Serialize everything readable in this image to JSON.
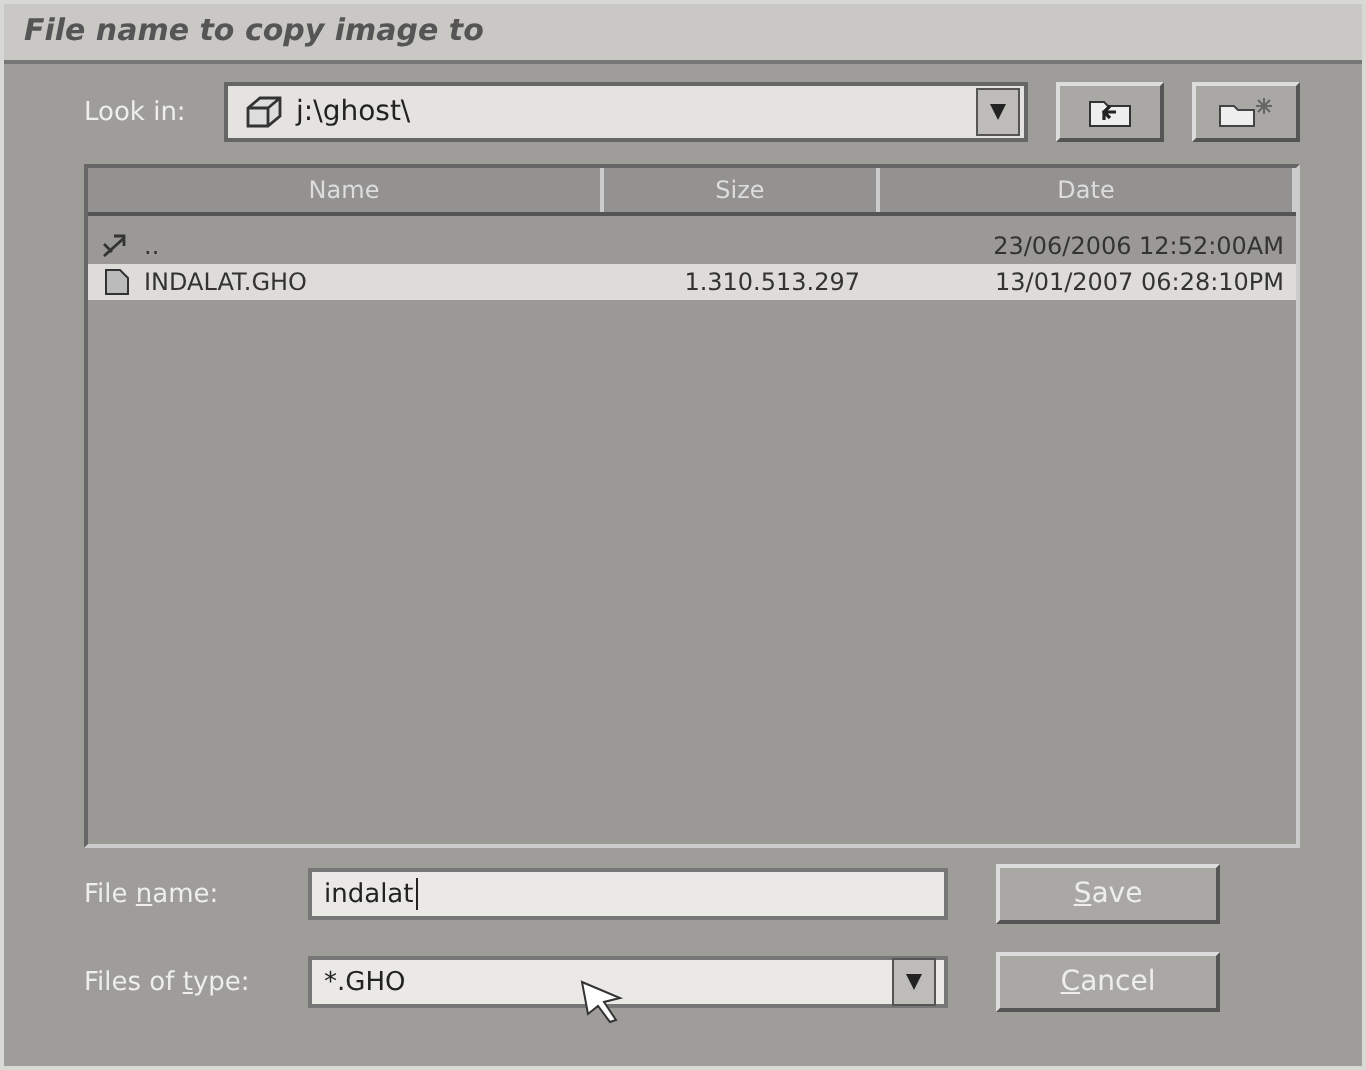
{
  "window": {
    "title": "File name to copy image to"
  },
  "look_in": {
    "label": "Look in:",
    "value": "j:\\ghost\\"
  },
  "table": {
    "columns": [
      "Name",
      "Size",
      "Date"
    ],
    "rows": [
      {
        "name": "..",
        "date": "23/06/2006 12:52:00AM",
        "kind": "parent",
        "selected": false
      },
      {
        "name": "INDALAT.GHO",
        "size": "1.310.513.297",
        "date": "13/01/2007 06:28:10PM",
        "kind": "file",
        "selected": true
      }
    ]
  },
  "file_name": {
    "label": {
      "before": "File ",
      "underlined": "n",
      "after": "ame:"
    },
    "value": "indalat"
  },
  "file_type": {
    "label": {
      "before": "Files of ",
      "underlined": "t",
      "after": "ype:"
    },
    "value": "*.GHO"
  },
  "buttons": [
    {
      "label": {
        "underlined": "S",
        "after": "ave"
      }
    },
    {
      "label": {
        "underlined": "C",
        "after": "ancel"
      }
    }
  ]
}
